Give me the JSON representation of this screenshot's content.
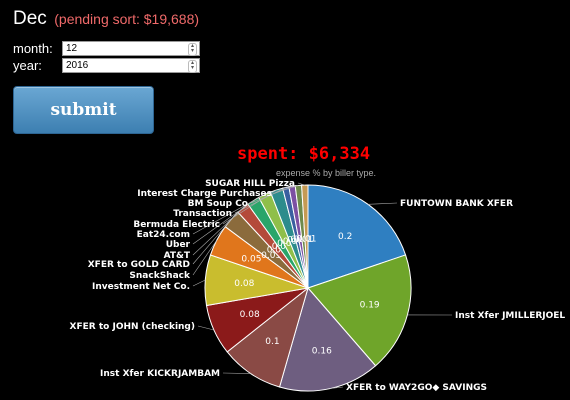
{
  "header": {
    "month_name": "Dec",
    "pending": "(pending sort: $19,688)"
  },
  "form": {
    "month_label": "month:",
    "month_value": "12",
    "year_label": "year:",
    "year_value": "2016",
    "submit_label": "submit"
  },
  "chart_header": {
    "spent": "spent: $6,334",
    "subtitle": "expense % by biller type."
  },
  "chart_data": {
    "type": "pie",
    "title": "expense % by biller type.",
    "slices": [
      {
        "label": "FUNTOWN BANK XFER",
        "value": 0.2,
        "color": "#2f7fc1"
      },
      {
        "label": "Inst Xfer JMILLERJOEL",
        "value": 0.19,
        "color": "#6fa52a"
      },
      {
        "label": "XFER to WAY2GO◆ SAVINGS",
        "value": 0.16,
        "color": "#6e5e80"
      },
      {
        "label": "Inst Xfer KICKRJAMBAM",
        "value": 0.1,
        "color": "#8a4a45"
      },
      {
        "label": "XFER to JOHN (checking)",
        "value": 0.08,
        "color": "#8b1a1a"
      },
      {
        "label": "Investment Net Co.",
        "value": 0.08,
        "color": "#c9bd2e"
      },
      {
        "label": "SnackShack",
        "value": 0.05,
        "color": "#e0761c"
      },
      {
        "label": "XFER to GOLD CARD",
        "value": 0.03,
        "color": "#8b6b3c"
      },
      {
        "label": "AT&T",
        "value": 0.02,
        "color": "#b44a3a"
      },
      {
        "label": "Uber",
        "value": 0.02,
        "color": "#2aa56a"
      },
      {
        "label": "Eat24.com",
        "value": 0.02,
        "color": "#8fbf4a"
      },
      {
        "label": "Bermuda Electric",
        "value": 0.02,
        "color": "#2c8c8c"
      },
      {
        "label": "Transaction",
        "value": 0.01,
        "color": "#3a5fa0"
      },
      {
        "label": "BM Soup Co",
        "value": 0.01,
        "color": "#7c4fa3"
      },
      {
        "label": "Interest Charge Purchases",
        "value": 0.01,
        "color": "#6e8a4c"
      },
      {
        "label": "SUGAR HILL Pizza",
        "value": 0.01,
        "color": "#c59a54"
      }
    ],
    "value_labels": [
      "0.2",
      "0.19",
      "0.16",
      "0.1",
      "0.08",
      "0.08",
      "0.05",
      "0.03",
      "0.02",
      "0.02",
      "0.02",
      "0.02",
      "0.01",
      "0.01",
      "0.01",
      "0.01"
    ]
  }
}
